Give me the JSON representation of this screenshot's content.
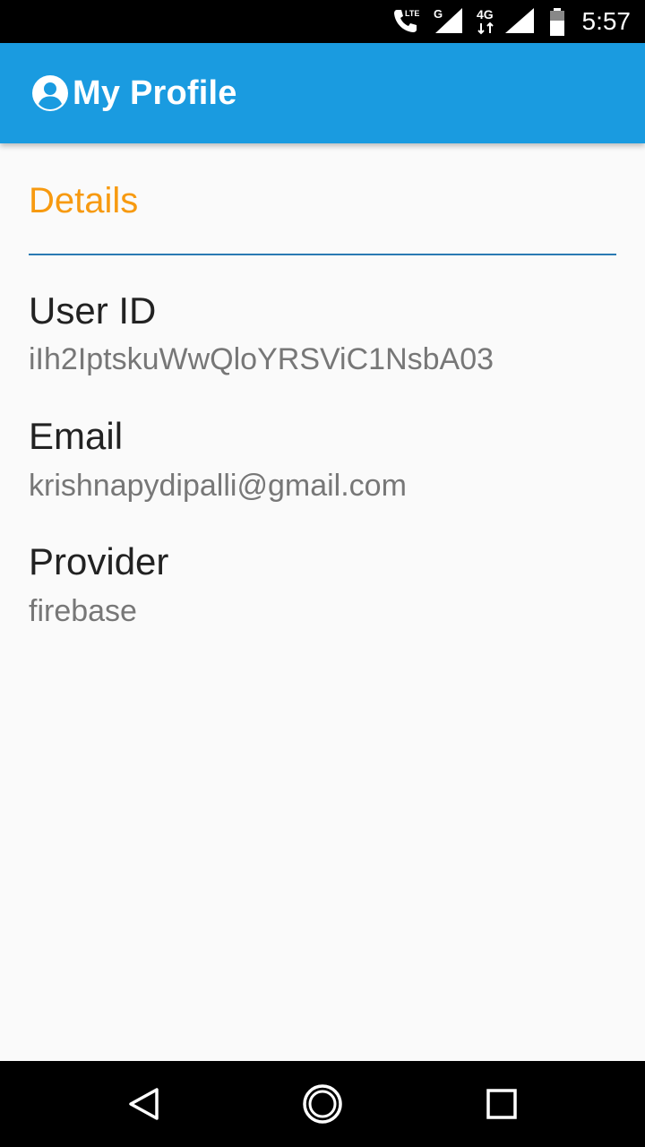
{
  "status_bar": {
    "clock": "5:57",
    "network_label_lte": "LTE",
    "network_label_g": "G",
    "network_label_4g": "4G",
    "icons": [
      "phone-lte-icon",
      "signal-g-icon",
      "signal-4g-icon",
      "battery-icon"
    ]
  },
  "app_bar": {
    "title": "My Profile",
    "icon": "account-circle-icon",
    "color": "#1a9be0"
  },
  "details": {
    "section_title": "Details",
    "section_title_color": "#f79a10",
    "fields": [
      {
        "label": "User ID",
        "value": "iIh2IptskuWwQloYRSViC1NsbA03"
      },
      {
        "label": "Email",
        "value": "krishnapydipalli@gmail.com"
      },
      {
        "label": "Provider",
        "value": "firebase"
      }
    ]
  },
  "nav_bar": {
    "icons": [
      "back-triangle-icon",
      "home-circle-icon",
      "recents-square-icon"
    ]
  }
}
